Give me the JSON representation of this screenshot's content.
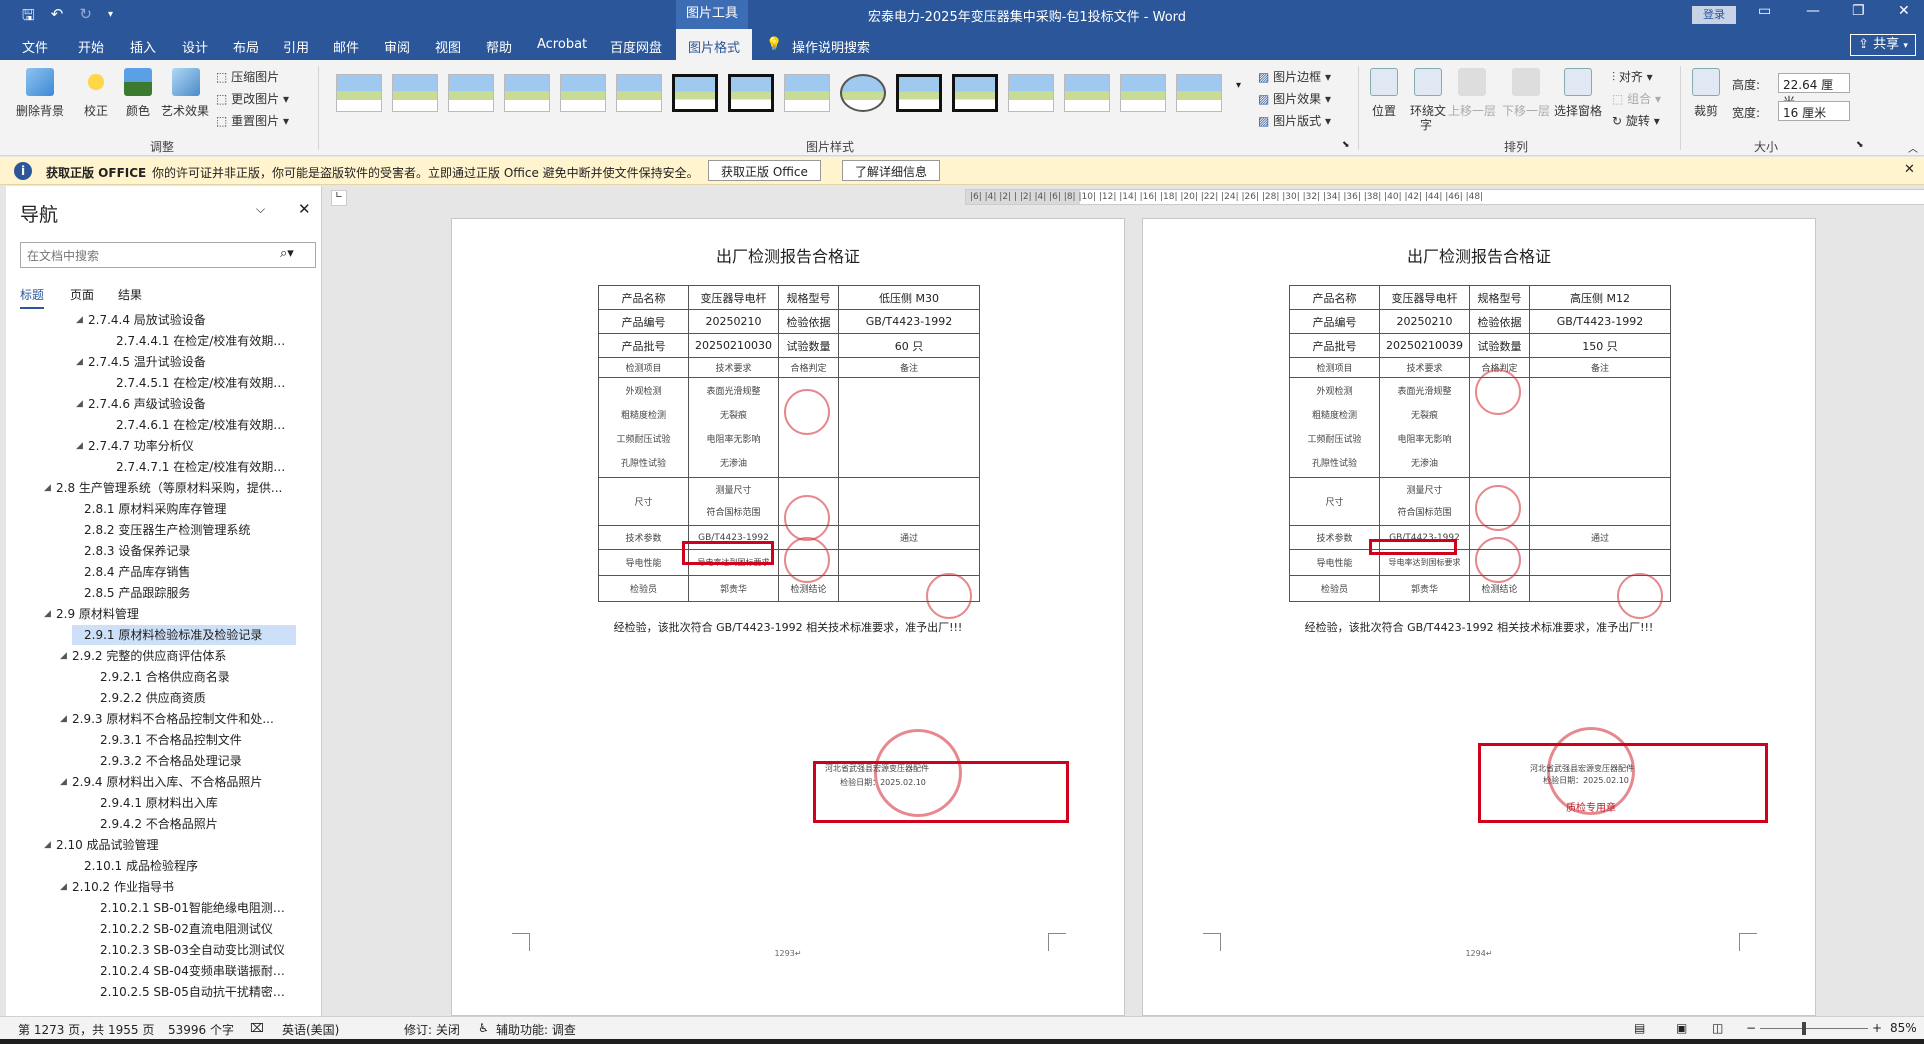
{
  "titlebar": {
    "doc_title": "宏泰电力-2025年变压器集中采购-包1投标文件 - Word",
    "context_tab": "图片工具",
    "login": "登录",
    "qat_icons": [
      "save-icon",
      "undo-icon",
      "redo-icon",
      "customize-icon"
    ]
  },
  "tabs": [
    "文件",
    "开始",
    "插入",
    "设计",
    "布局",
    "引用",
    "邮件",
    "审阅",
    "视图",
    "帮助",
    "Acrobat",
    "百度网盘",
    "图片格式"
  ],
  "active_tab": "图片格式",
  "tell_me": "操作说明搜索",
  "share": "共享",
  "ribbon": {
    "adjust": {
      "remove_bg": "删除背景",
      "correct": "校正",
      "color": "颜色",
      "art_effects": "艺术效果",
      "compress": "压缩图片",
      "change": "更改图片",
      "reset": "重置图片",
      "group_label": "调整"
    },
    "styles_group_label": "图片样式",
    "border": "图片边框",
    "effects": "图片效果",
    "layout": "图片版式",
    "arrange": {
      "position": "位置",
      "wrap_line1": "环绕文",
      "wrap_line2": "字",
      "bring_forward": "上移一层",
      "send_backward": "下移一层",
      "select_pane": "选择窗格",
      "align": "对齐",
      "group": "组合",
      "rotate": "旋转",
      "group_label": "排列"
    },
    "size": {
      "crop": "裁剪",
      "height_label": "高度:",
      "height_value": "22.64 厘米",
      "width_label": "宽度:",
      "width_value": "16 厘米",
      "group_label": "大小"
    }
  },
  "infobar": {
    "title": "获取正版 OFFICE",
    "message": "你的许可证并非正版，你可能是盗版软件的受害者。立即通过正版 Office 避免中断并使文件保持安全。",
    "btn_get": "获取正版 Office",
    "btn_more": "了解详细信息"
  },
  "nav": {
    "title": "导航",
    "search_placeholder": "在文档中搜索",
    "tabs": [
      "标题",
      "页面",
      "结果"
    ],
    "items": [
      {
        "t": "2.7.4.4 局放试验设备",
        "indent": 1,
        "tri": true
      },
      {
        "t": "2.7.4.4.1 在检定/校准有效期内...",
        "indent": 2,
        "tri": false
      },
      {
        "t": "2.7.4.5 温升试验设备",
        "indent": 1,
        "tri": true
      },
      {
        "t": "2.7.4.5.1 在检定/校准有效期内...",
        "indent": 2,
        "tri": false
      },
      {
        "t": "2.7.4.6 声级试验设备",
        "indent": 1,
        "tri": true
      },
      {
        "t": "2.7.4.6.1 在检定/校准有效期内...",
        "indent": 2,
        "tri": false
      },
      {
        "t": "2.7.4.7 功率分析仪",
        "indent": 1,
        "tri": true
      },
      {
        "t": "2.7.4.7.1 在检定/校准有效期内...",
        "indent": 2,
        "tri": false
      },
      {
        "t": "2.8 生产管理系统（等原材料采购，提供...",
        "indent": -1,
        "tri": true
      },
      {
        "t": "2.8.1 原材料采购库存管理",
        "indent": 0,
        "tri": false
      },
      {
        "t": "2.8.2 变压器生产检测管理系统",
        "indent": 0,
        "tri": false
      },
      {
        "t": "2.8.3 设备保养记录",
        "indent": 0,
        "tri": false
      },
      {
        "t": "2.8.4 产品库存销售",
        "indent": 0,
        "tri": false
      },
      {
        "t": "2.8.5 产品跟踪服务",
        "indent": 0,
        "tri": false
      },
      {
        "t": "2.9 原材料管理",
        "indent": -1,
        "tri": true
      },
      {
        "t": "2.9.1 原材料检验标准及检验记录",
        "indent": 0,
        "tri": false,
        "sel": true
      },
      {
        "t": "2.9.2 完整的供应商评估体系",
        "indent": 0,
        "tri": true
      },
      {
        "t": "2.9.2.1 合格供应商名录",
        "indent": 1,
        "tri": false
      },
      {
        "t": "2.9.2.2 供应商资质",
        "indent": 1,
        "tri": false
      },
      {
        "t": "2.9.3 原材料不合格品控制文件和处...",
        "indent": 0,
        "tri": true
      },
      {
        "t": "2.9.3.1 不合格品控制文件",
        "indent": 1,
        "tri": false
      },
      {
        "t": "2.9.3.2 不合格品处理记录",
        "indent": 1,
        "tri": false
      },
      {
        "t": "2.9.4 原材料出入库、不合格品照片",
        "indent": 0,
        "tri": true
      },
      {
        "t": "2.9.4.1 原材料出入库",
        "indent": 1,
        "tri": false
      },
      {
        "t": "2.9.4.2 不合格品照片",
        "indent": 1,
        "tri": false
      },
      {
        "t": "2.10 成品试验管理",
        "indent": -1,
        "tri": true
      },
      {
        "t": "2.10.1 成品检验程序",
        "indent": 0,
        "tri": false
      },
      {
        "t": "2.10.2 作业指导书",
        "indent": 0,
        "tri": true
      },
      {
        "t": "2.10.2.1 SB-01智能绝缘电阻测试仪",
        "indent": 1,
        "tri": false
      },
      {
        "t": "2.10.2.2 SB-02直流电阻测试仪",
        "indent": 1,
        "tri": false
      },
      {
        "t": "2.10.2.3 SB-03全自动变比测试仪",
        "indent": 1,
        "tri": false
      },
      {
        "t": "2.10.2.4 SB-04变频串联谐振耐压...",
        "indent": 1,
        "tri": false
      },
      {
        "t": "2.10.2.5 SB-05自动抗干扰精密介...",
        "indent": 1,
        "tri": false
      }
    ]
  },
  "ruler_text": "|6| |4| |2| |  |2| |4| |6| |8| |10| |12| |14| |16| |18| |20| |22| |24| |26| |28| |30| |32| |34| |36| |38| |40| |42| |44| |46| |48|",
  "pages": [
    {
      "title": "出厂检测报告合格证",
      "product_name_label": "产品名称",
      "product_name": "变压器导电杆",
      "spec_label": "规格型号",
      "spec": "低压侧 M30",
      "code_label": "产品编号",
      "code": "20250210",
      "basis_label": "检验依据",
      "basis": "GB/T4423-1992",
      "batch_label": "产品批号",
      "batch": "20250210030",
      "qty_label": "试验数量",
      "qty": "60 只",
      "h_item": "检测项目",
      "h_req": "技术要求",
      "h_judge": "合格判定",
      "h_note": "备注",
      "rows_a": [
        "外观检测",
        "粗糙度检测",
        "工频耐压试验",
        "孔隙性试验"
      ],
      "reqs_a": [
        "表面光滑规整",
        "无裂痕",
        "电阻率无影响",
        "无渗油"
      ],
      "size_label": "尺寸",
      "size_req1": "测量尺寸",
      "size_req2": "符合国标范围",
      "tech_label": "技术参数",
      "tech_req": "GB/T4423-1992",
      "tech_result": "通过",
      "cond_label": "导电性能",
      "cond_req": "导电率达到国标要求",
      "inspector_label": "检验员",
      "inspector": "郭贵华",
      "result_label": "检测结论",
      "conclusion": "经检验，该批次符合 GB/T4423-1992 相关技术标准要求，准予出厂!!!",
      "stamp_line1": "河北省武强县宏源变压器配件",
      "stamp_line2": "检验日期：2025.02.10",
      "page_no": "1293↵"
    },
    {
      "title": "出厂检测报告合格证",
      "product_name_label": "产品名称",
      "product_name": "变压器导电杆",
      "spec_label": "规格型号",
      "spec": "高压侧 M12",
      "code_label": "产品编号",
      "code": "20250210",
      "basis_label": "检验依据",
      "basis": "GB/T4423-1992",
      "batch_label": "产品批号",
      "batch": "20250210039",
      "qty_label": "试验数量",
      "qty": "150 只",
      "h_item": "检测项目",
      "h_req": "技术要求",
      "h_judge": "合格判定",
      "h_note": "备注",
      "rows_a": [
        "外观检测",
        "粗糙度检测",
        "工频耐压试验",
        "孔隙性试验"
      ],
      "reqs_a": [
        "表面光滑规整",
        "无裂痕",
        "电阻率无影响",
        "无渗油"
      ],
      "size_label": "尺寸",
      "size_req1": "测量尺寸",
      "size_req2": "符合国标范围",
      "tech_label": "技术参数",
      "tech_req": "GB/T4423-1992",
      "tech_result": "通过",
      "cond_label": "导电性能",
      "cond_req": "导电率达到国标要求",
      "inspector_label": "检验员",
      "inspector": "郭贵华",
      "result_label": "检测结论",
      "conclusion": "经检验，该批次符合 GB/T4423-1992 相关技术标准要求，准予出厂!!!",
      "stamp_line1": "河北省武强县宏源变压器配件",
      "stamp_line2": "检验日期：2025.02.10",
      "stamp_line3": "质检专用章",
      "page_no": "1294↵"
    }
  ],
  "status": {
    "page": "第 1273 页，共 1955 页",
    "words": "53996 个字",
    "lang": "英语(美国)",
    "track": "修订: 关闭",
    "access": "辅助功能: 调查",
    "zoom": "85%"
  },
  "colors": {
    "word_blue": "#2b579a",
    "red_box": "#d0021b",
    "info_bg": "#fff4ce"
  }
}
